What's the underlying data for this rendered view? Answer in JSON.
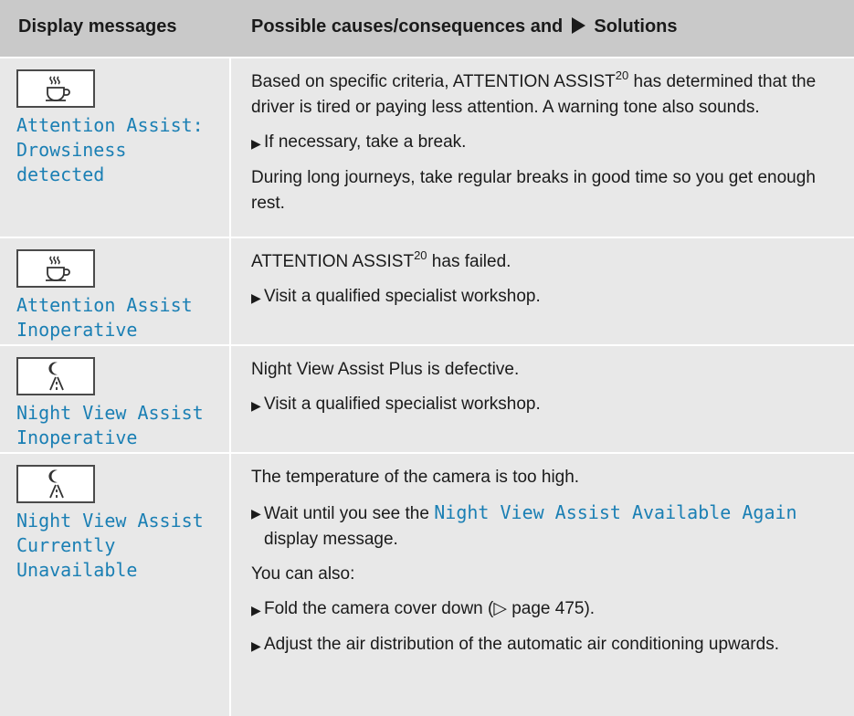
{
  "header": {
    "col1": "Display messages",
    "col2_a": "Possible causes/consequences and",
    "col2_b": "Solutions"
  },
  "rows": [
    {
      "icon": "coffee-cup-icon",
      "message": "Attention Assist:\nDrowsiness\ndetected",
      "cause_a": "Based on specific criteria, ATTENTION ASSIST",
      "cause_sup": "20",
      "cause_b": " has determined that the driver is tired or paying less attention. A warning tone also sounds.",
      "step1": "If necessary, take a break.",
      "note": "During long journeys, take regular breaks in good time so you get enough rest."
    },
    {
      "icon": "coffee-cup-icon",
      "message": "Attention Assist\nInoperative",
      "cause_a": "ATTENTION ASSIST",
      "cause_sup": "20",
      "cause_b": " has failed.",
      "step1": "Visit a qualified specialist workshop."
    },
    {
      "icon": "night-view-road-icon",
      "message": "Night View Assist\nInoperative",
      "cause": "Night View Assist Plus is defective.",
      "step1": "Visit a qualified specialist workshop."
    },
    {
      "icon": "night-view-road-icon",
      "message": "Night View Assist\nCurrently\nUnavailable",
      "cause": "The temperature of the camera is too high.",
      "step1_a": "Wait until you see the ",
      "step1_code": "Night View Assist Available Again",
      "step1_b": " display message.",
      "also": "You can also:",
      "step2": "Fold the camera cover down (▷ page 475).",
      "step3": "Adjust the air distribution of the automatic air conditioning upwards."
    }
  ]
}
